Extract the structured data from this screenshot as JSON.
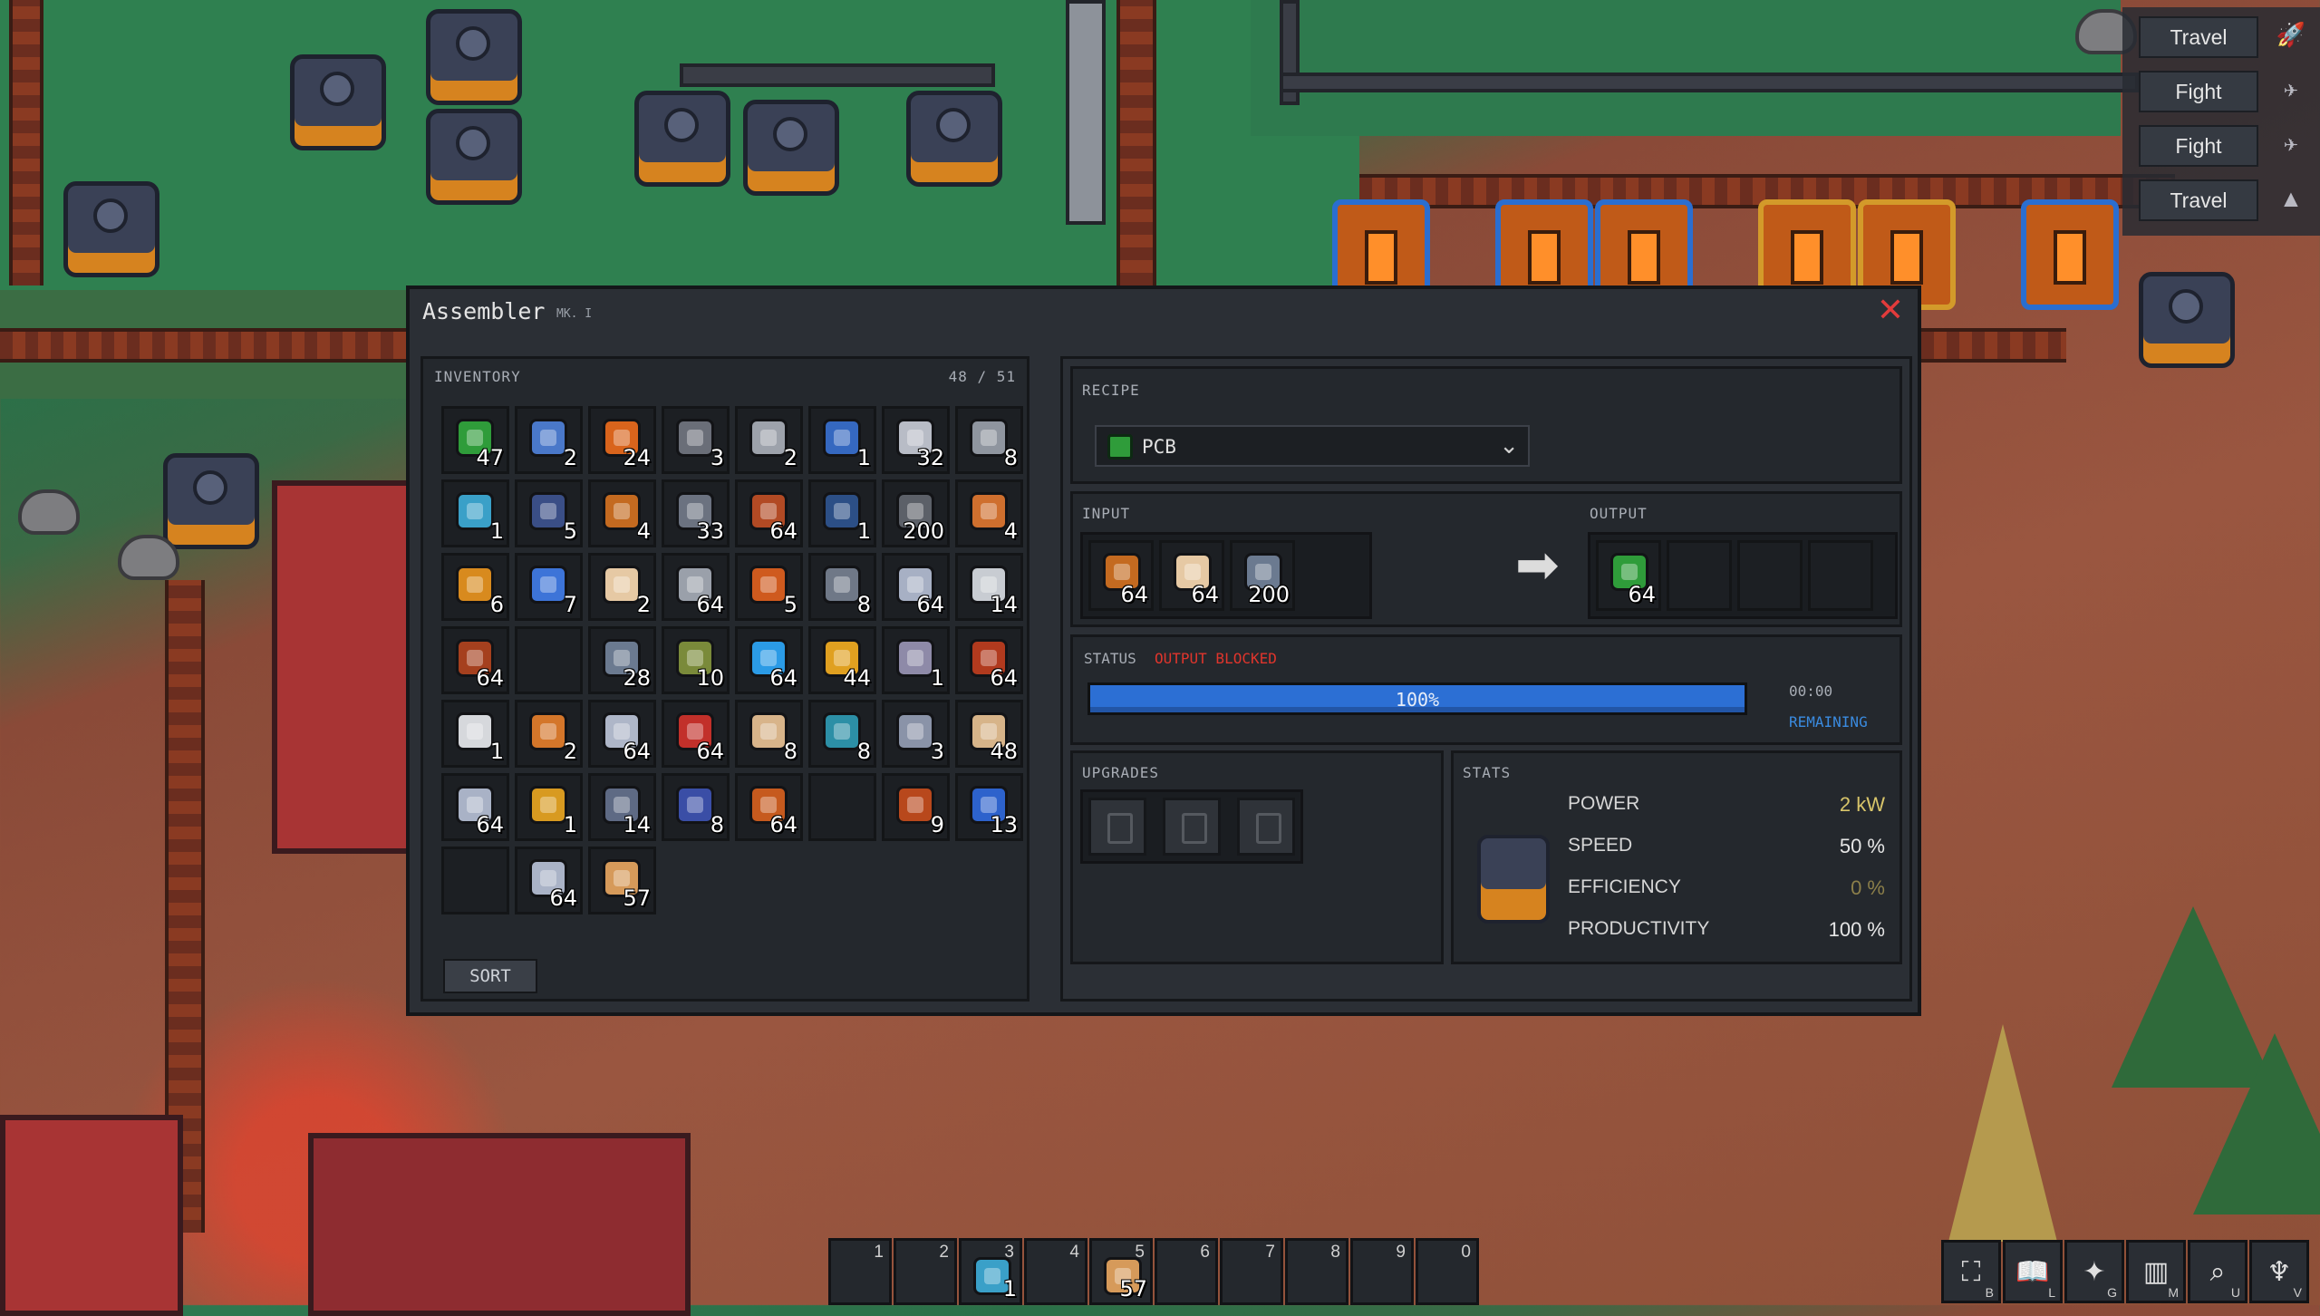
{
  "window": {
    "title": "Assembler",
    "tier": "MK. I",
    "close_glyph": "✕"
  },
  "sidenav": [
    {
      "label": "Travel",
      "icon": "rocket-icon",
      "glyph": "🚀"
    },
    {
      "label": "Fight",
      "icon": "ship-icon",
      "glyph": "✈"
    },
    {
      "label": "Fight",
      "icon": "ship-icon",
      "glyph": "✈"
    },
    {
      "label": "Travel",
      "icon": "ship-dark-icon",
      "glyph": "▲"
    }
  ],
  "inventory": {
    "label": "INVENTORY",
    "capacity": "48 / 51",
    "sort_label": "SORT",
    "slots": [
      {
        "qty": "47",
        "color": "#2f9c3a",
        "icon": "pcb-icon"
      },
      {
        "qty": "2",
        "color": "#4a78c9",
        "icon": "robot-arm-icon"
      },
      {
        "qty": "24",
        "color": "#d9641c",
        "icon": "copper-ore-icon"
      },
      {
        "qty": "3",
        "color": "#6a6e78",
        "icon": "drill-icon"
      },
      {
        "qty": "2",
        "color": "#9da2ab",
        "icon": "gear-tank-icon"
      },
      {
        "qty": "1",
        "color": "#3568c0",
        "icon": "blue-machine-icon"
      },
      {
        "qty": "32",
        "color": "#b8bcc6",
        "icon": "steel-plate-icon"
      },
      {
        "qty": "8",
        "color": "#8f959f",
        "icon": "iron-plate-icon"
      },
      {
        "qty": "1",
        "color": "#3aa0c8",
        "icon": "conveyor-icon"
      },
      {
        "qty": "5",
        "color": "#3a4e86",
        "icon": "assembler-icon"
      },
      {
        "qty": "4",
        "color": "#c46a20",
        "icon": "copper-coil-icon"
      },
      {
        "qty": "33",
        "color": "#6b7280",
        "icon": "inserter-icon"
      },
      {
        "qty": "64",
        "color": "#b24a24",
        "icon": "copper-ingot-icon"
      },
      {
        "qty": "1",
        "color": "#2c4f86",
        "icon": "generator-icon"
      },
      {
        "qty": "200",
        "color": "#5c6068",
        "icon": "screws-icon"
      },
      {
        "qty": "4",
        "color": "#cf6f2e",
        "icon": "copper-plate-icon"
      },
      {
        "qty": "6",
        "color": "#d88a1e",
        "icon": "furnace-icon"
      },
      {
        "qty": "7",
        "color": "#3d74d8",
        "icon": "storage-icon"
      },
      {
        "qty": "2",
        "color": "#e6c9a4",
        "icon": "plastic-icon"
      },
      {
        "qty": "64",
        "color": "#9aa0aa",
        "icon": "iron-ingot-icon"
      },
      {
        "qty": "5",
        "color": "#cf5a1e",
        "icon": "motor-icon"
      },
      {
        "qty": "8",
        "color": "#6f7887",
        "icon": "pipe-icon"
      },
      {
        "qty": "64",
        "color": "#a7b0c4",
        "icon": "stone-brick-icon"
      },
      {
        "qty": "14",
        "color": "#c8ccd2",
        "icon": "concrete-icon"
      },
      {
        "qty": "64",
        "color": "#a5401e",
        "icon": "copper-ingot-icon"
      },
      {
        "qty": "",
        "color": "",
        "icon": ""
      },
      {
        "qty": "28",
        "color": "#6b7a90",
        "icon": "splitter-icon"
      },
      {
        "qty": "10",
        "color": "#7a8a3a",
        "icon": "wire-icon"
      },
      {
        "qty": "64",
        "color": "#2b9be6",
        "icon": "ice-cube-icon"
      },
      {
        "qty": "44",
        "color": "#e0a020",
        "icon": "battery-icon"
      },
      {
        "qty": "1",
        "color": "#8e8aa8",
        "icon": "crystal-icon"
      },
      {
        "qty": "64",
        "color": "#b13a1e",
        "icon": "copper-ingot-icon"
      },
      {
        "qty": "1",
        "color": "#d6d8dc",
        "icon": "drone-icon"
      },
      {
        "qty": "2",
        "color": "#d4762a",
        "icon": "fuel-icon"
      },
      {
        "qty": "64",
        "color": "#aeb6c8",
        "icon": "stone-icon"
      },
      {
        "qty": "64",
        "color": "#c2302a",
        "icon": "potion-icon"
      },
      {
        "qty": "8",
        "color": "#d8b48a",
        "icon": "sand-icon"
      },
      {
        "qty": "8",
        "color": "#2c8fa6",
        "icon": "glass-icon"
      },
      {
        "qty": "3",
        "color": "#8a93a8",
        "icon": "rod-icon"
      },
      {
        "qty": "48",
        "color": "#d7b489",
        "icon": "sand-pile-icon"
      },
      {
        "qty": "64",
        "color": "#a9b2c6",
        "icon": "stone-icon"
      },
      {
        "qty": "1",
        "color": "#d89a20",
        "icon": "lab-icon"
      },
      {
        "qty": "14",
        "color": "#5e6a84",
        "icon": "gear-icon"
      },
      {
        "qty": "8",
        "color": "#3a4ea6",
        "icon": "blueprint-icon"
      },
      {
        "qty": "64",
        "color": "#c65a1e",
        "icon": "copper-ore-icon"
      },
      {
        "qty": "",
        "color": "",
        "icon": ""
      },
      {
        "qty": "9",
        "color": "#b8481c",
        "icon": "coal-icon"
      },
      {
        "qty": "13",
        "color": "#2d62cc",
        "icon": "smelter-icon"
      },
      {
        "qty": "",
        "color": "",
        "icon": ""
      },
      {
        "qty": "64",
        "color": "#aab3c7",
        "icon": "stone-icon"
      },
      {
        "qty": "57",
        "color": "#d69a5a",
        "icon": "book-icon"
      }
    ]
  },
  "recipe": {
    "label": "RECIPE",
    "selected": "PCB",
    "input_label": "INPUT",
    "output_label": "OUTPUT",
    "inputs": [
      {
        "qty": "64",
        "color": "#c46a20",
        "icon": "copper-coil-icon"
      },
      {
        "qty": "64",
        "color": "#e6c9a4",
        "icon": "plastic-icon"
      },
      {
        "qty": "200",
        "color": "#6b7a90",
        "icon": "screws-icon"
      }
    ],
    "outputs": [
      {
        "qty": "64",
        "color": "#2f9c3a",
        "icon": "pcb-icon"
      },
      {
        "qty": "",
        "color": "",
        "icon": ""
      },
      {
        "qty": "",
        "color": "",
        "icon": ""
      },
      {
        "qty": "",
        "color": "",
        "icon": ""
      }
    ]
  },
  "status": {
    "label": "STATUS",
    "state": "OUTPUT BLOCKED",
    "state_color": "#e0352c",
    "progress": 1.0,
    "progress_text": "100%",
    "time": "00:00",
    "remaining_label": "REMAINING"
  },
  "upgrades": {
    "label": "UPGRADES",
    "slots": 3
  },
  "stats": {
    "label": "STATS",
    "rows": [
      {
        "label": "POWER",
        "value": "2 kW",
        "color": "#d8c56a"
      },
      {
        "label": "SPEED",
        "value": "50 %",
        "color": "#e6e6e6"
      },
      {
        "label": "EFFICIENCY",
        "value": "0 %",
        "color": "#8c7f4a"
      },
      {
        "label": "PRODUCTIVITY",
        "value": "100 %",
        "color": "#e6e6e6"
      }
    ]
  },
  "hotbar": [
    {
      "num": "1",
      "qty": "",
      "color": ""
    },
    {
      "num": "2",
      "qty": "",
      "color": ""
    },
    {
      "num": "3",
      "qty": "1",
      "color": "#3aa0c8"
    },
    {
      "num": "4",
      "qty": "",
      "color": ""
    },
    {
      "num": "5",
      "qty": "57",
      "color": "#d69a5a"
    },
    {
      "num": "6",
      "qty": "",
      "color": ""
    },
    {
      "num": "7",
      "qty": "",
      "color": ""
    },
    {
      "num": "8",
      "qty": "",
      "color": ""
    },
    {
      "num": "9",
      "qty": "",
      "color": ""
    },
    {
      "num": "0",
      "qty": "",
      "color": ""
    }
  ],
  "toolbar": [
    {
      "key": "B",
      "icon": "build-icon",
      "glyph": "⛶"
    },
    {
      "key": "L",
      "icon": "research-book-icon",
      "glyph": "📖"
    },
    {
      "key": "G",
      "icon": "sparkle-icon",
      "glyph": "✦"
    },
    {
      "key": "M",
      "icon": "map-icon",
      "glyph": "▥"
    },
    {
      "key": "U",
      "icon": "search-icon",
      "glyph": "⌕"
    },
    {
      "key": "V",
      "icon": "torch-icon",
      "glyph": "♆"
    }
  ]
}
